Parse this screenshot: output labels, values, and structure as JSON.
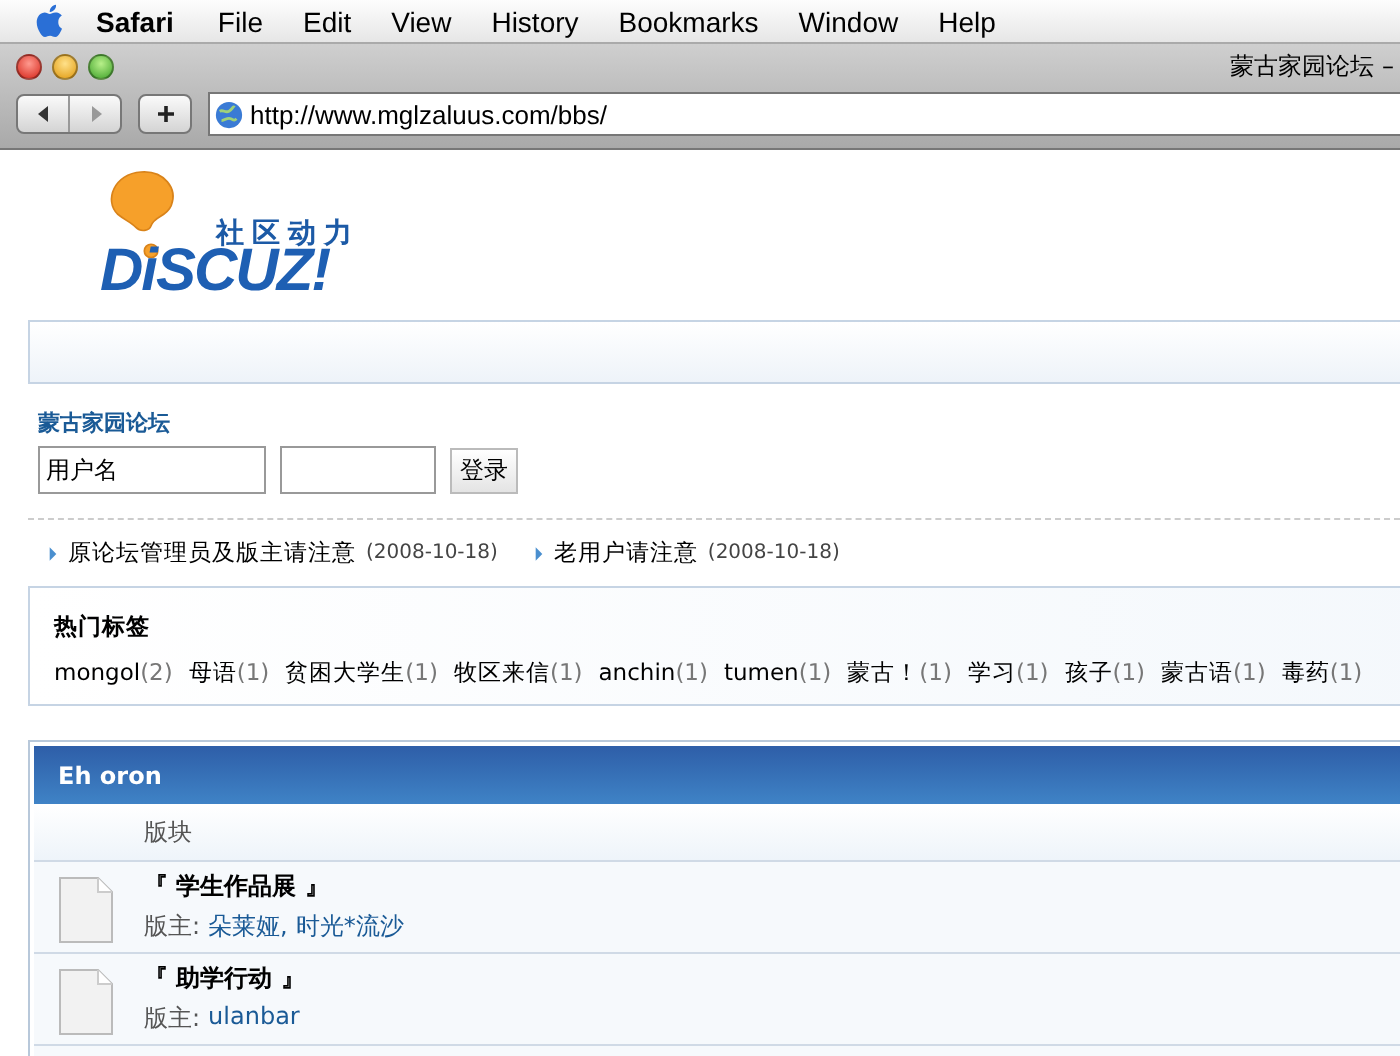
{
  "menu_bar": {
    "app": "Safari",
    "items": [
      "File",
      "Edit",
      "View",
      "History",
      "Bookmarks",
      "Window",
      "Help"
    ]
  },
  "window": {
    "title": "蒙古家园论坛 –"
  },
  "toolbar": {
    "address": "http://www.mglzaluus.com/bbs/"
  },
  "logo": {
    "tagline": "社区动力",
    "wordmark": "DiSCUZ!"
  },
  "login": {
    "site_name": "蒙古家园论坛",
    "username_placeholder": "用户名",
    "submit": "登录"
  },
  "announcements": [
    {
      "title": "原论坛管理员及版主请注意",
      "date": "(2008-10-18)"
    },
    {
      "title": "老用户请注意",
      "date": "(2008-10-18)"
    }
  ],
  "hot_tags": {
    "title": "热门标签",
    "tags": [
      {
        "name": "mongol",
        "count": "(2)"
      },
      {
        "name": "母语",
        "count": "(1)"
      },
      {
        "name": "贫困大学生",
        "count": "(1)"
      },
      {
        "name": "牧区来信",
        "count": "(1)"
      },
      {
        "name": "anchin",
        "count": "(1)"
      },
      {
        "name": "tumen",
        "count": "(1)"
      },
      {
        "name": "蒙古！",
        "count": "(1)"
      },
      {
        "name": "学习",
        "count": "(1)"
      },
      {
        "name": "孩子",
        "count": "(1)"
      },
      {
        "name": "蒙古语",
        "count": "(1)"
      },
      {
        "name": "毒药",
        "count": "(1)"
      }
    ]
  },
  "forum_category": {
    "title": "Eh oron",
    "column_header": "版块",
    "forums": [
      {
        "name": "『 学生作品展 』",
        "moderator_label": "版主:",
        "moderators": [
          "朵莱娅,",
          "时光*流沙"
        ]
      },
      {
        "name": "『 助学行动 』",
        "moderator_label": "版主:",
        "moderators": [
          "ulanbar"
        ]
      }
    ]
  }
}
